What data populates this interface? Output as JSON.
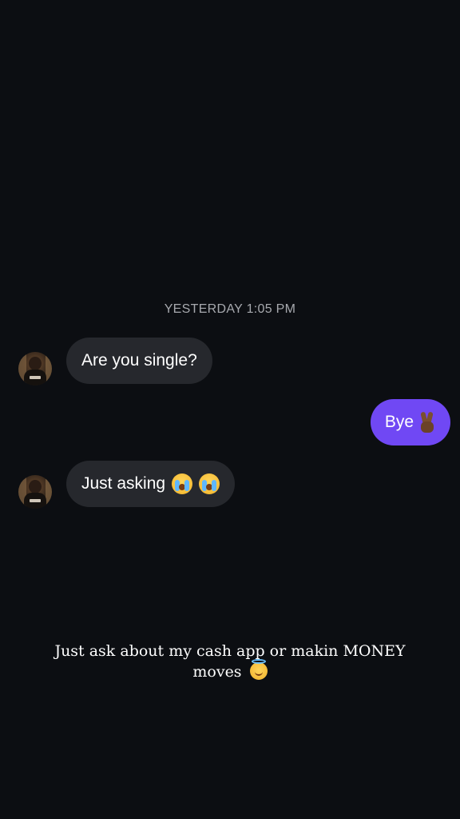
{
  "thread": {
    "timestamp": "YESTERDAY 1:05 PM",
    "messages": [
      {
        "direction": "incoming",
        "text": "Are you single?",
        "emoji": []
      },
      {
        "direction": "outgoing",
        "text": "Bye",
        "emoji": [
          "victory-hand"
        ]
      },
      {
        "direction": "incoming",
        "text": "Just asking",
        "emoji": [
          "loudly-crying-face",
          "loudly-crying-face"
        ]
      }
    ]
  },
  "caption": {
    "line1": "Just ask about my cash app or makin MONEY",
    "line2": "moves",
    "emoji": "smiling-face-with-halo"
  },
  "colors": {
    "background": "#0c0e12",
    "incoming_bubble": "#26282d",
    "outgoing_bubble": "#7048f4",
    "timestamp_text": "#a7a9ae"
  }
}
